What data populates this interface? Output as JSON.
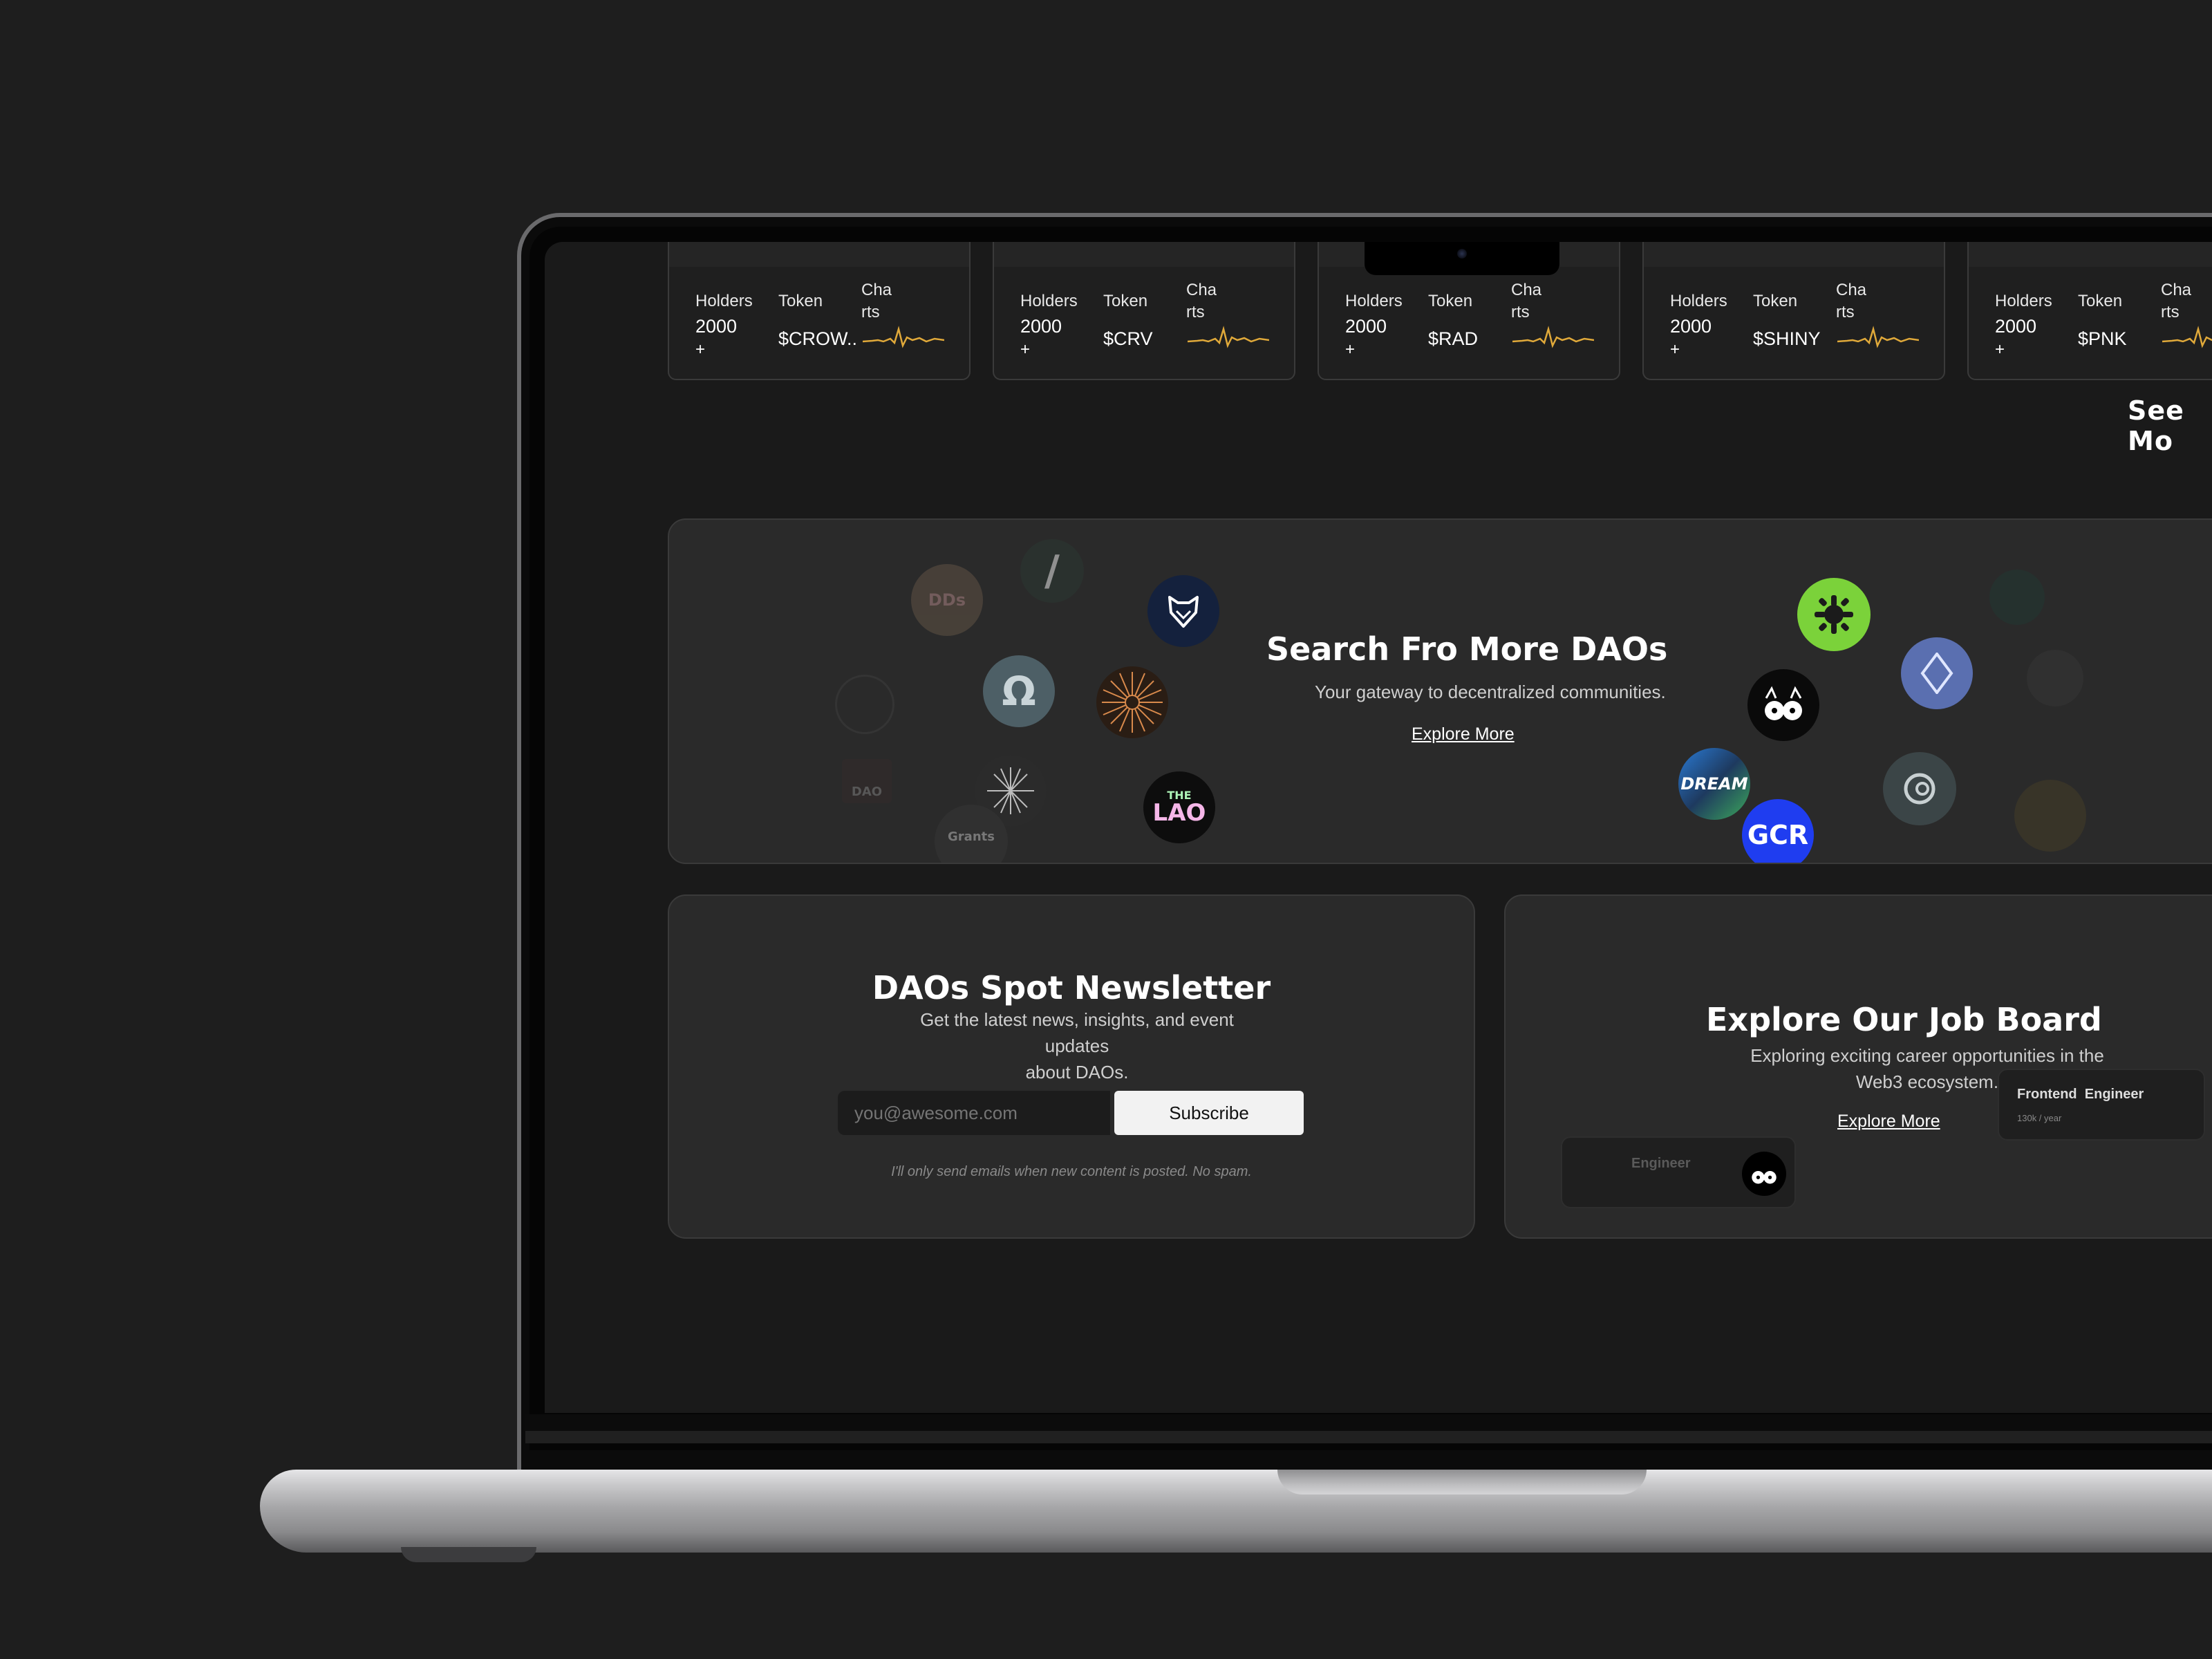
{
  "token_cards": [
    {
      "holders_label": "Holders",
      "holders_value": "2000",
      "holders_suffix": "+",
      "token_label": "Token",
      "token_value": "$CROW..",
      "charts_label_1": "Cha",
      "charts_label_2": "rts"
    },
    {
      "holders_label": "Holders",
      "holders_value": "2000",
      "holders_suffix": "+",
      "token_label": "Token",
      "token_value": "$CRV",
      "charts_label_1": "Cha",
      "charts_label_2": "rts"
    },
    {
      "holders_label": "Holders",
      "holders_value": "2000",
      "holders_suffix": "+",
      "token_label": "Token",
      "token_value": "$RAD",
      "charts_label_1": "Cha",
      "charts_label_2": "rts"
    },
    {
      "holders_label": "Holders",
      "holders_value": "2000",
      "holders_suffix": "+",
      "token_label": "Token",
      "token_value": "$SHINY",
      "charts_label_1": "Cha",
      "charts_label_2": "rts"
    },
    {
      "holders_label": "Holders",
      "holders_value": "2000",
      "holders_suffix": "+",
      "token_label": "Token",
      "token_value": "$PNK",
      "charts_label_1": "Cha",
      "charts_label_2": "rts"
    }
  ],
  "see_more": "See Mo",
  "search_banner": {
    "title": "Search Fro More DAOs",
    "subtitle": "Your gateway to decentralized communities.",
    "link": "Explore More",
    "logos": [
      {
        "text": "DDs",
        "icon": "dds-logo-icon"
      },
      {
        "text": "/",
        "icon": "slash-logo-icon"
      },
      {
        "text": "",
        "icon": "shapeshift-fox-logo-icon"
      },
      {
        "text": "Ω",
        "icon": "omega-logo-icon"
      },
      {
        "text": "",
        "icon": "sunburst-logo-icon"
      },
      {
        "text": "",
        "icon": "starburst-logo-icon"
      },
      {
        "text": "THE",
        "icon": "the-lao-logo-icon",
        "text2": "LAO"
      },
      {
        "text": "Grants",
        "icon": "grants-logo-icon"
      },
      {
        "text": "DAO",
        "icon": "dao-square-logo-icon"
      },
      {
        "text": "",
        "icon": "green-gear-logo-icon"
      },
      {
        "text": "",
        "icon": "ens-diamond-logo-icon"
      },
      {
        "text": "",
        "icon": "cat-mask-logo-icon"
      },
      {
        "text": "DREAM",
        "icon": "dream-dao-logo-icon"
      },
      {
        "text": "GCR",
        "icon": "gcr-logo-icon"
      },
      {
        "text": "",
        "icon": "coin-logo-icon"
      }
    ]
  },
  "newsletter": {
    "title": "DAOs Spot Newsletter",
    "subtitle_lines": [
      "Get the latest news, insights, and event",
      "updates",
      "about DAOs."
    ],
    "email_placeholder": "you@awesome.com",
    "subscribe_label": "Subscribe",
    "note": "I'll only send emails when new content is posted. No spam."
  },
  "job_board": {
    "title": "Explore Our Job Board",
    "subtitle_lines": [
      "Exploring exciting career opportunities in the",
      "Web3 ecosystem."
    ],
    "link": "Explore More",
    "card_right_title": "Frontend  Engineer",
    "card_right_salary": "130k / year",
    "card_left_title": "Engineer"
  },
  "colors": {
    "chart_line": "#e0a93a",
    "background": "#1e1e1e",
    "screen": "#1a1a1a",
    "card": "#2a2a2a"
  }
}
